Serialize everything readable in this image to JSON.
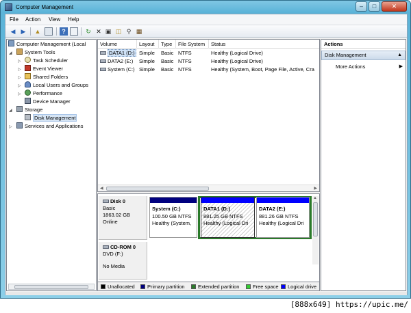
{
  "window": {
    "title": "Computer Management"
  },
  "menu": [
    "File",
    "Action",
    "View",
    "Help"
  ],
  "toolbar": {
    "icons": [
      "back-arrow-icon",
      "forward-arrow-icon",
      "up-folder-icon",
      "show-hide-tree-icon",
      "help-icon",
      "properties-icon",
      "refresh-icon",
      "delete-icon",
      "properties-sheet-icon",
      "open-icon",
      "search-icon",
      "export-icon"
    ]
  },
  "tree": [
    {
      "label": "Computer Management (Local",
      "icon": "computer-icon"
    },
    {
      "label": "System Tools",
      "icon": "tools-icon"
    },
    {
      "label": "Task Scheduler",
      "icon": "clock-icon"
    },
    {
      "label": "Event Viewer",
      "icon": "event-viewer-icon"
    },
    {
      "label": "Shared Folders",
      "icon": "shared-folder-icon"
    },
    {
      "label": "Local Users and Groups",
      "icon": "users-icon"
    },
    {
      "label": "Performance",
      "icon": "performance-icon"
    },
    {
      "label": "Device Manager",
      "icon": "device-manager-icon"
    },
    {
      "label": "Storage",
      "icon": "storage-icon"
    },
    {
      "label": "Disk Management",
      "icon": "disk-icon"
    },
    {
      "label": "Services and Applications",
      "icon": "services-icon"
    }
  ],
  "volume_list": {
    "columns": [
      "Volume",
      "Layout",
      "Type",
      "File System",
      "Status"
    ],
    "rows": [
      [
        "DATA1 (D:)",
        "Simple",
        "Basic",
        "NTFS",
        "Healthy (Logical Drive)"
      ],
      [
        "DATA2 (E:)",
        "Simple",
        "Basic",
        "NTFS",
        "Healthy (Logical Drive)"
      ],
      [
        "System (C:)",
        "Simple",
        "Basic",
        "NTFS",
        "Healthy (System, Boot, Page File, Active, Cra"
      ]
    ]
  },
  "disks": {
    "disk0": {
      "name": "Disk 0",
      "type": "Basic",
      "size": "1863.02 GB",
      "status": "Online"
    },
    "cdrom0": {
      "name": "CD-ROM 0",
      "type": "DVD (F:)",
      "media": "No Media"
    }
  },
  "partitions": [
    {
      "name": "System  (C:)",
      "size": "100.50 GB NTFS",
      "status": "Healthy (System, ",
      "color": "#00007f"
    },
    {
      "name": "DATA1  (D:)",
      "size": "881.25 GB NTFS",
      "status": "Healthy (Logical Dri",
      "color": "#0000ff"
    },
    {
      "name": "DATA2  (E:)",
      "size": "881.26 GB NTFS",
      "status": "Healthy (Logical Dri",
      "color": "#0000ff"
    }
  ],
  "legend": [
    {
      "label": "Unallocated",
      "color": "#000000"
    },
    {
      "label": "Primary partition",
      "color": "#00007f"
    },
    {
      "label": "Extended partition",
      "color": "#2a7a2a"
    },
    {
      "label": "Free space",
      "color": "#33cc33"
    },
    {
      "label": "Logical drive",
      "color": "#0000ff"
    }
  ],
  "actions": {
    "header": "Actions",
    "section": "Disk Management",
    "items": [
      "More Actions"
    ]
  },
  "watermark": "[888x649] https://upic.me/"
}
